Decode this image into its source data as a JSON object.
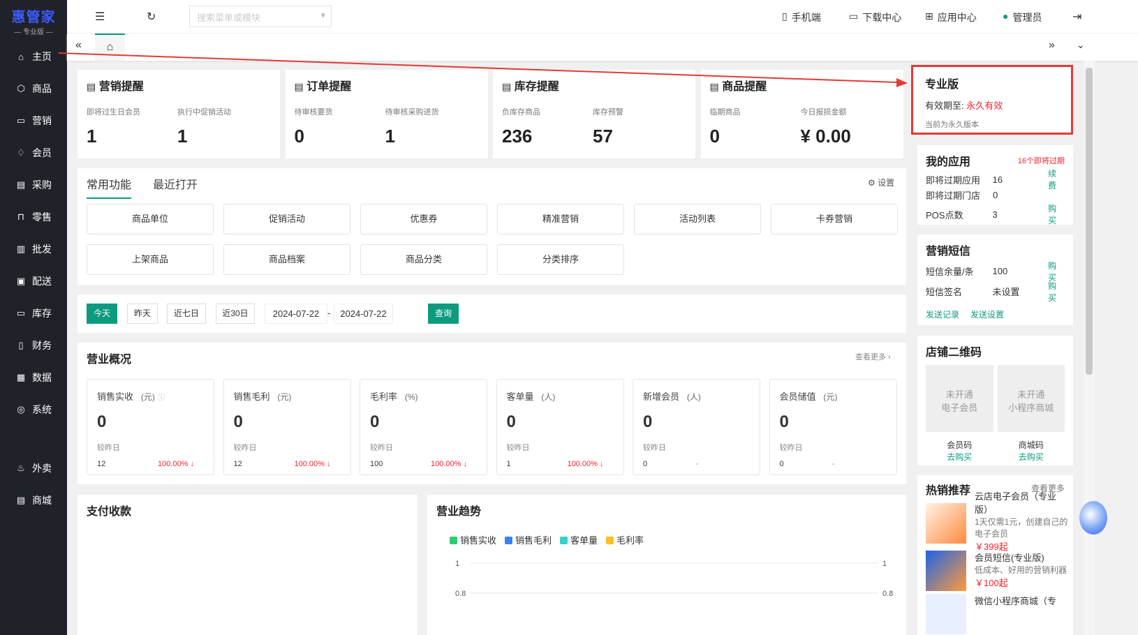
{
  "brand": {
    "name": "惠管家",
    "edition": "— 专业版 —"
  },
  "sidebar": [
    {
      "label": "主页",
      "icon": "home-icon",
      "g": "⌂"
    },
    {
      "label": "商品",
      "icon": "box-icon",
      "g": "⬡"
    },
    {
      "label": "营销",
      "icon": "chart-icon",
      "g": "▭"
    },
    {
      "label": "会员",
      "icon": "diamond-icon",
      "g": "♢"
    },
    {
      "label": "采购",
      "icon": "purchase-icon",
      "g": "▤"
    },
    {
      "label": "零售",
      "icon": "bag-icon",
      "g": "⊓"
    },
    {
      "label": "批发",
      "icon": "building-icon",
      "g": "▥"
    },
    {
      "label": "配送",
      "icon": "delivery-icon",
      "g": "▣"
    },
    {
      "label": "库存",
      "icon": "inventory-icon",
      "g": "▭"
    },
    {
      "label": "财务",
      "icon": "finance-icon",
      "g": "▯"
    },
    {
      "label": "数据",
      "icon": "data-icon",
      "g": "▦"
    },
    {
      "label": "系统",
      "icon": "settings-icon",
      "g": "◎"
    },
    {
      "label": "外卖",
      "icon": "takeout-icon",
      "g": "♨"
    },
    {
      "label": "商城",
      "icon": "shop-icon",
      "g": "▤"
    }
  ],
  "topbar": {
    "search_placeholder": "搜索菜单或模块",
    "mobile": "手机端",
    "download": "下载中心",
    "apps": "应用中心",
    "user": "管理员"
  },
  "reminders": [
    {
      "title": "营销提醒",
      "items": [
        {
          "label": "即将过生日会员",
          "value": "1"
        },
        {
          "label": "执行中促销活动",
          "value": "1"
        }
      ]
    },
    {
      "title": "订单提醒",
      "items": [
        {
          "label": "待审核要货",
          "value": "0"
        },
        {
          "label": "待审核采购进货",
          "value": "1"
        }
      ]
    },
    {
      "title": "库存提醒",
      "items": [
        {
          "label": "负库存商品",
          "value": "236"
        },
        {
          "label": "库存预警",
          "value": "57"
        }
      ]
    },
    {
      "title": "商品提醒",
      "items": [
        {
          "label": "临期商品",
          "value": "0"
        },
        {
          "label": "今日报损金额",
          "value": "¥ 0.00"
        }
      ]
    }
  ],
  "edition": {
    "title": "专业版",
    "expiry_label": "有效期至:",
    "expiry_value": "永久有效",
    "note": "当前为永久版本"
  },
  "functions": {
    "tabs": [
      "常用功能",
      "最近打开"
    ],
    "settings": "设置",
    "buttons": [
      "商品单位",
      "促销活动",
      "优惠券",
      "精准营销",
      "活动列表",
      "卡券营销",
      "上架商品",
      "商品档案",
      "商品分类",
      "分类排序"
    ]
  },
  "date_filter": {
    "buttons": [
      "今天",
      "昨天",
      "近七日",
      "近30日"
    ],
    "start": "2024-07-22",
    "sep": "-",
    "end": "2024-07-22",
    "query": "查询"
  },
  "overview": {
    "title": "营业概况",
    "more": "查看更多 ›",
    "compare_label": "较昨日",
    "metrics": [
      {
        "label": "销售实收",
        "unit": "(元)",
        "value": "0",
        "prev": "12",
        "change": "100.00% ↓"
      },
      {
        "label": "销售毛利",
        "unit": "(元)",
        "value": "0",
        "prev": "12",
        "change": "100.00% ↓"
      },
      {
        "label": "毛利率",
        "unit": "(%)",
        "value": "0",
        "prev": "100",
        "change": "100.00% ↓"
      },
      {
        "label": "客单量",
        "unit": "(人)",
        "value": "0",
        "prev": "1",
        "change": "100.00% ↓"
      },
      {
        "label": "新增会员",
        "unit": "(人)",
        "value": "0",
        "prev": "0",
        "change": "-"
      },
      {
        "label": "会员储值",
        "unit": "(元)",
        "value": "0",
        "prev": "0",
        "change": "-"
      }
    ]
  },
  "payment": {
    "title": "支付收款"
  },
  "trend": {
    "title": "营业趋势"
  },
  "chart_data": {
    "type": "line",
    "title": "营业趋势",
    "series": [
      {
        "name": "销售实收",
        "color": "#2ecc71",
        "values": []
      },
      {
        "name": "销售毛利",
        "color": "#3b82f6",
        "values": []
      },
      {
        "name": "客单量",
        "color": "#36cfc9",
        "values": []
      },
      {
        "name": "毛利率",
        "color": "#fbbf24",
        "values": []
      }
    ],
    "y_ticks_left": [
      "1",
      "0.8"
    ],
    "y_ticks_right": [
      "1",
      "0.8"
    ]
  },
  "my_apps": {
    "title": "我的应用",
    "badge": "16个即将过期",
    "rows": [
      {
        "label": "即将过期应用",
        "value": "16",
        "action": "续费"
      },
      {
        "label": "即将过期门店",
        "value": "0",
        "action": ""
      },
      {
        "label": "POS点数",
        "value": "3",
        "action": "购买"
      }
    ]
  },
  "sms": {
    "title": "营销短信",
    "rows": [
      {
        "label": "短信余量/条",
        "value": "100",
        "action": "购买"
      },
      {
        "label": "短信签名",
        "value": "未设置",
        "action": "购买"
      }
    ],
    "links": [
      "发送记录",
      "发送设置"
    ]
  },
  "qrcode": {
    "title": "店铺二维码",
    "items": [
      {
        "box": "未开通\n电子会员",
        "label": "会员码",
        "action": "去购买"
      },
      {
        "box": "未开通\n小程序商城",
        "label": "商城码",
        "action": "去购买"
      }
    ]
  },
  "hot": {
    "title": "热销推荐",
    "more": "查看更多",
    "items": [
      {
        "name": "云店电子会员（专业版）",
        "desc": "1天仅需1元，创建自己的电子会员",
        "price": "￥399起"
      },
      {
        "name": "会员短信(专业版)",
        "desc": "低成本、好用的营销利器",
        "price": "￥100起"
      },
      {
        "name": "微信小程序商城（专",
        "desc": "",
        "price": ""
      }
    ]
  }
}
